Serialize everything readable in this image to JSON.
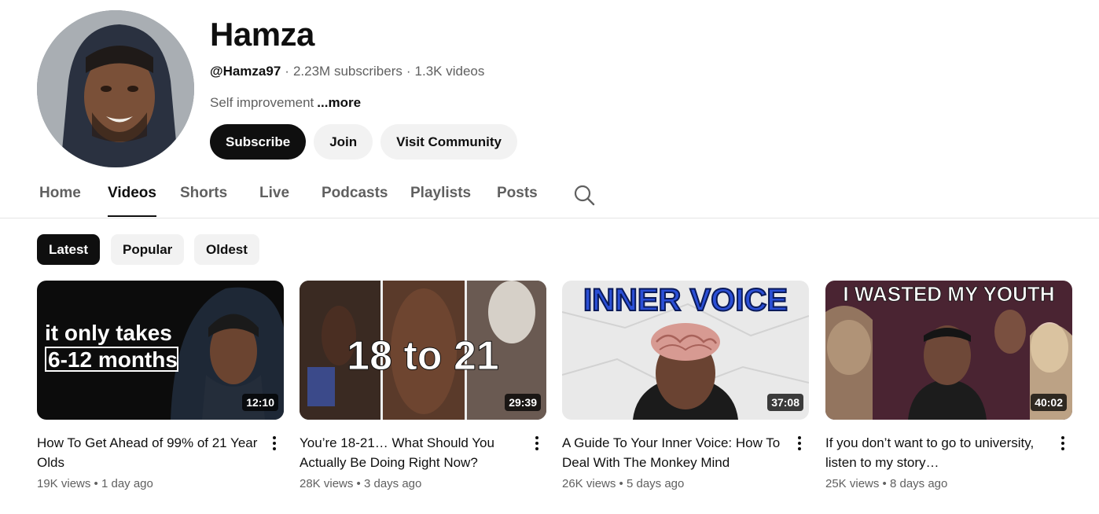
{
  "channel": {
    "name": "Hamza",
    "handle": "@Hamza97",
    "subscribers": "2.23M subscribers",
    "videos_count": "1.3K videos",
    "description": "Self improvement",
    "more_label": "...more",
    "separator": "·"
  },
  "actions": {
    "subscribe": "Subscribe",
    "join": "Join",
    "community": "Visit Community"
  },
  "tabs": [
    "Home",
    "Videos",
    "Shorts",
    "Live",
    "Podcasts",
    "Playlists",
    "Posts"
  ],
  "active_tab": "Videos",
  "chips": [
    "Latest",
    "Popular",
    "Oldest"
  ],
  "active_chip": "Latest",
  "videos": [
    {
      "thumb_text_1": "it only takes",
      "thumb_text_2": "6-12 months",
      "duration": "12:10",
      "title": "How To Get Ahead of 99% of 21 Year Olds",
      "views": "19K views",
      "age": "1 day ago"
    },
    {
      "thumb_text_1": "18 to 21",
      "duration": "29:39",
      "title": "You’re 18-21… What Should You Actually Be Doing Right Now?",
      "views": "28K views",
      "age": "3 days ago"
    },
    {
      "thumb_text_1": "INNER VOICE",
      "duration": "37:08",
      "title": "A Guide To Your Inner Voice: How To Deal With The Monkey Mind",
      "views": "26K views",
      "age": "5 days ago"
    },
    {
      "thumb_text_1": "I WASTED MY YOUTH",
      "duration": "40:02",
      "title": "If you don’t want to go to university, listen to my story…",
      "views": "25K views",
      "age": "8 days ago"
    }
  ],
  "colors": {
    "primary_text": "#0f0f0f",
    "secondary_text": "#606060",
    "chip_bg": "#f2f2f2",
    "inner_voice_blue": "#2b4fd6"
  },
  "icons": {
    "search": "search-icon",
    "more": "more-vert-icon"
  }
}
